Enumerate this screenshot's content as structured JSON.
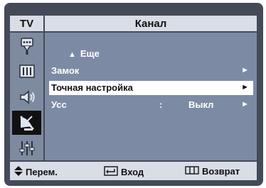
{
  "header": {
    "tv_label": "TV",
    "title": "Канал"
  },
  "sidebar": {
    "icons": [
      "antenna-icon",
      "picture-icon",
      "sound-icon",
      "channel-icon",
      "setup-icon"
    ],
    "active": "channel-icon"
  },
  "menu": {
    "up_label": "Еще",
    "items": [
      {
        "label": "Замок",
        "value": "",
        "arrow": "►"
      },
      {
        "label": "Точная настройка",
        "value": "",
        "arrow": "►",
        "selected": true
      },
      {
        "label": "Усс",
        "colon": ":",
        "value": "Выкл",
        "arrow": "►"
      }
    ]
  },
  "footer": {
    "move": "Перем.",
    "enter": "Вход",
    "return": "Возврат"
  }
}
